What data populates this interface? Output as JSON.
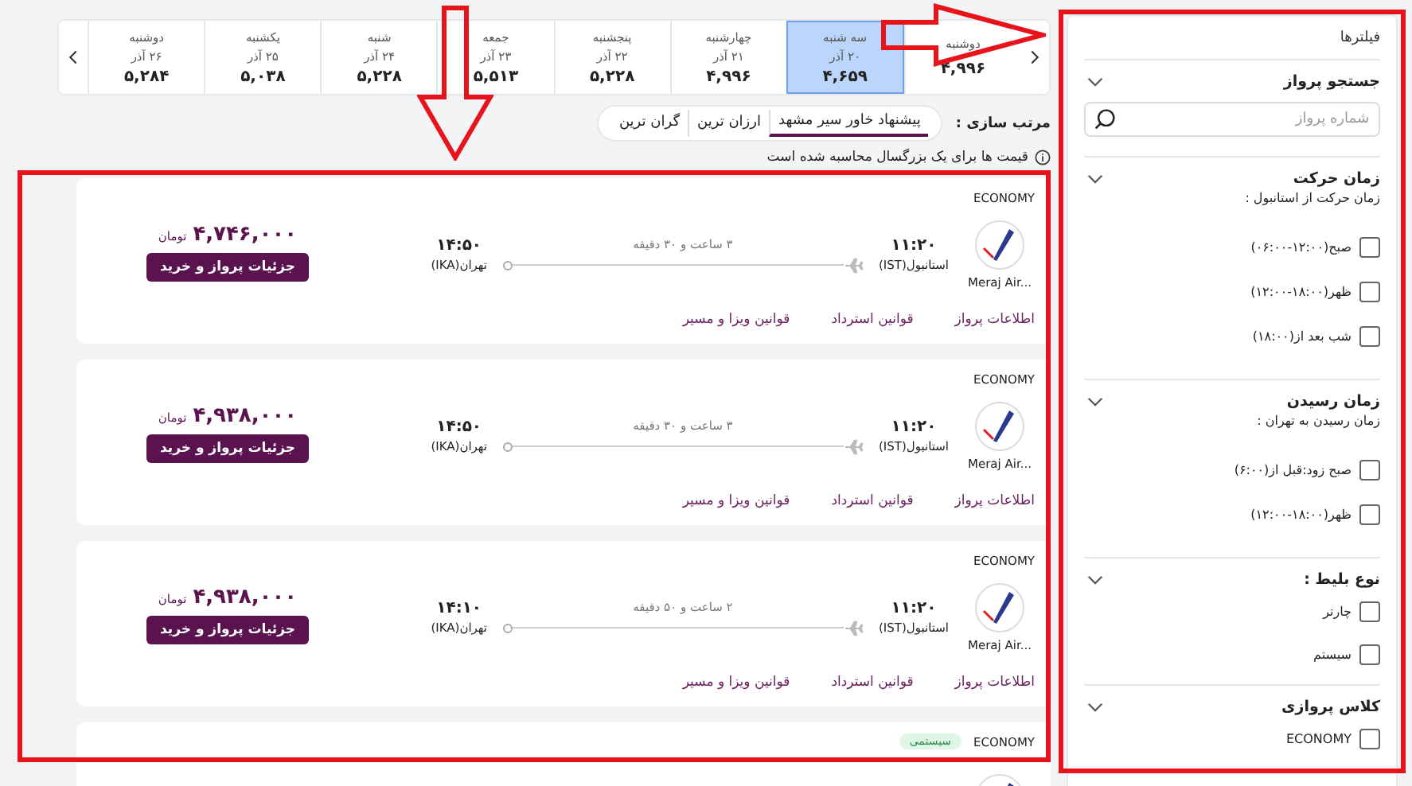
{
  "date_strip": {
    "days": [
      {
        "day": "دوشنبه",
        "price": "۴,۹۹۶",
        "selected": false
      },
      {
        "day": "سه شنبه",
        "date": "۲۰ آذر",
        "price": "۴,۶۵۹",
        "selected": true
      },
      {
        "day": "چهارشنبه",
        "date": "۲۱ آذر",
        "price": "۴,۹۹۶",
        "selected": false
      },
      {
        "day": "پنجشنبه",
        "date": "۲۲ آذر",
        "price": "۵,۲۲۸",
        "selected": false
      },
      {
        "day": "جمعه",
        "date": "۲۳ آذر",
        "price": "۵,۵۱۳",
        "selected": false
      },
      {
        "day": "شنبه",
        "date": "۲۴ آذر",
        "price": "۵,۲۲۸",
        "selected": false
      },
      {
        "day": "یکشنبه",
        "date": "۲۵ آذر",
        "price": "۵,۰۳۸",
        "selected": false
      },
      {
        "day": "دوشنبه",
        "date": "۲۶ آذر",
        "price": "۵,۲۸۴",
        "selected": false
      }
    ]
  },
  "sort": {
    "label": "مرتب سازی :",
    "options": [
      {
        "label": "پیشنهاد خاور سیر مشهد",
        "selected": true
      },
      {
        "label": "ارزان ترین",
        "selected": false
      },
      {
        "label": "گران ترین",
        "selected": false
      }
    ]
  },
  "price_note": "قیمت ها برای یک بزرگسال محاسبه شده است",
  "flights": [
    {
      "cabin": "ECONOMY",
      "airline": "Meraj Air...",
      "dep_time": "۱۱:۲۰",
      "dep_city": "استانبول(IST)",
      "duration": "۳ ساعت و ۳۰ دقیقه",
      "arr_time": "۱۴:۵۰",
      "arr_city": "تهران(IKA)",
      "price": "۴,۷۴۶,۰۰۰",
      "currency": "تومان",
      "button": "جزئیات پرواز و خرید",
      "links": [
        "اطلاعات پرواز",
        "قوانین استرداد",
        "قوانین ویزا و مسیر"
      ]
    },
    {
      "cabin": "ECONOMY",
      "airline": "Meraj Air...",
      "dep_time": "۱۱:۲۰",
      "dep_city": "استانبول(IST)",
      "duration": "۳ ساعت و ۳۰ دقیقه",
      "arr_time": "۱۴:۵۰",
      "arr_city": "تهران(IKA)",
      "price": "۴,۹۳۸,۰۰۰",
      "currency": "تومان",
      "button": "جزئیات پرواز و خرید",
      "links": [
        "اطلاعات پرواز",
        "قوانین استرداد",
        "قوانین ویزا و مسیر"
      ]
    },
    {
      "cabin": "ECONOMY",
      "airline": "Meraj Air...",
      "dep_time": "۱۱:۲۰",
      "dep_city": "استانبول(IST)",
      "duration": "۲ ساعت و ۵۰ دقیقه",
      "arr_time": "۱۴:۱۰",
      "arr_city": "تهران(IKA)",
      "price": "۴,۹۳۸,۰۰۰",
      "currency": "تومان",
      "button": "جزئیات پرواز و خرید",
      "links": [
        "اطلاعات پرواز",
        "قوانین استرداد",
        "قوانین ویزا و مسیر"
      ]
    },
    {
      "cabin": "ECONOMY",
      "badge": "سیستمی"
    }
  ],
  "filters": {
    "title": "فیلترها",
    "sections": [
      {
        "kind": "search",
        "title": "جستجو پرواز",
        "expanded": true,
        "placeholder": "شماره پرواز"
      },
      {
        "kind": "checks",
        "title": "زمان حرکت",
        "expanded": true,
        "subtitle": "زمان حرکت از استانبول :",
        "options": [
          {
            "label": "صبح(۱۲:۰۰-۰۶:۰۰)",
            "checked": false
          },
          {
            "label": "ظهر(۱۸:۰۰-۱۲:۰۰)",
            "checked": false
          },
          {
            "label": "شب بعد از(۱۸:۰۰)",
            "checked": false
          }
        ]
      },
      {
        "kind": "checks",
        "title": "زمان رسیدن",
        "expanded": true,
        "subtitle": "زمان رسیدن به تهران :",
        "options": [
          {
            "label": "صبح زود:قبل از(۶:۰۰)",
            "checked": false
          },
          {
            "label": "ظهر(۱۸:۰۰-۱۲:۰۰)",
            "checked": false
          }
        ]
      },
      {
        "kind": "checks",
        "title": "نوع بلیط :",
        "expanded": true,
        "options": [
          {
            "label": "چارتر",
            "checked": false
          },
          {
            "label": "سیستم",
            "checked": false
          }
        ]
      },
      {
        "kind": "checks",
        "title": "کلاس پروازی",
        "expanded": true,
        "options": [
          {
            "label": "ECONOMY",
            "checked": false
          }
        ]
      }
    ]
  },
  "annotations": [
    {
      "kind": "frame"
    },
    {
      "kind": "frame"
    },
    {
      "kind": "arrow-down"
    },
    {
      "kind": "arrow-right"
    }
  ]
}
